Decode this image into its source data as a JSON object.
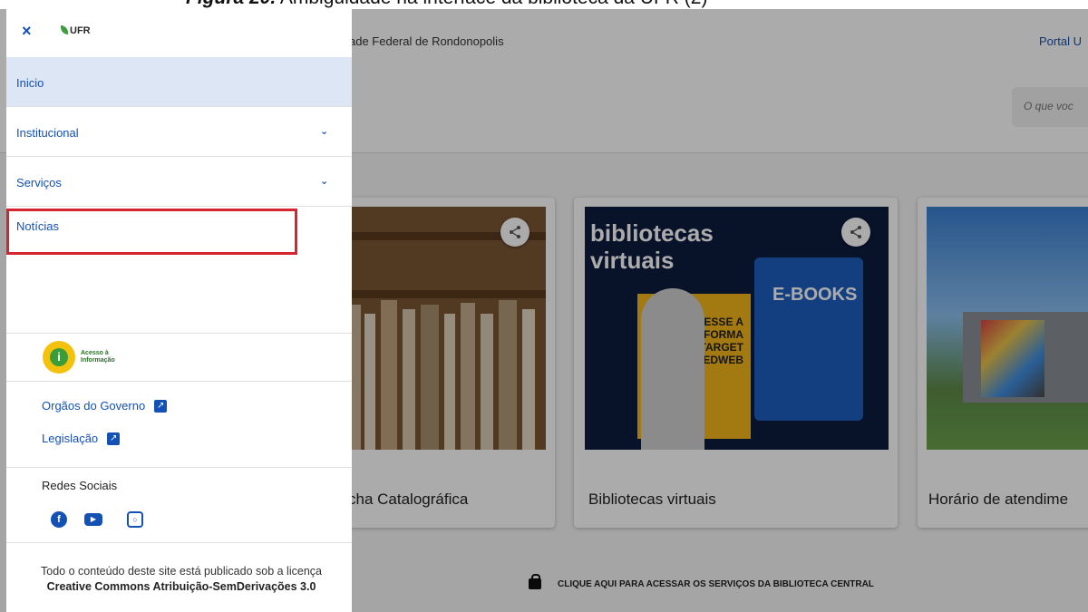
{
  "caption": {
    "bold": "Figura 20.",
    "text": " Ambiguidade na interface da biblioteca da UFR (2)"
  },
  "topbar": {
    "university": "ade Federal de Rondonopolis",
    "portal": "Portal U"
  },
  "search": {
    "placeholder": "O que voc"
  },
  "cards": [
    {
      "title": "cha Catalográfica"
    },
    {
      "title": "Bibliotecas virtuais",
      "image_heading": "bibliotecas\nvirtuais",
      "ebooks": "E-BOOKS",
      "target": "ACESSE A\nPLATAFORMA\nTARGET\nGEDWEB"
    },
    {
      "title": "Horário de atendime"
    }
  ],
  "footer_cta": "CLIQUE AQUI PARA ACESSAR OS SERVIÇOS DA BIBLIOTECA CENTRAL",
  "drawer": {
    "close": "×",
    "logo_text": "UFR",
    "nav": [
      {
        "label": "Inicio",
        "active": true
      },
      {
        "label": "Institucional",
        "expandable": true
      },
      {
        "label": "Serviços",
        "expandable": true
      },
      {
        "label": "Notícias",
        "highlighted": true
      }
    ],
    "access_info": "Acesso à\nInformação",
    "links": [
      {
        "label": "Orgãos do Governo"
      },
      {
        "label": "Legislação"
      }
    ],
    "social_title": "Redes Sociais",
    "social": [
      "facebook-icon",
      "youtube-icon",
      "instagram-icon"
    ],
    "license_prefix": "Todo o conteúdo deste site está publicado sob a licença ",
    "license_bold": "Creative Commons Atribuição-SemDerivações 3.0"
  },
  "colors": {
    "accent": "#1351b4",
    "highlight": "#d5262f",
    "active_bg": "#dce6f5"
  }
}
